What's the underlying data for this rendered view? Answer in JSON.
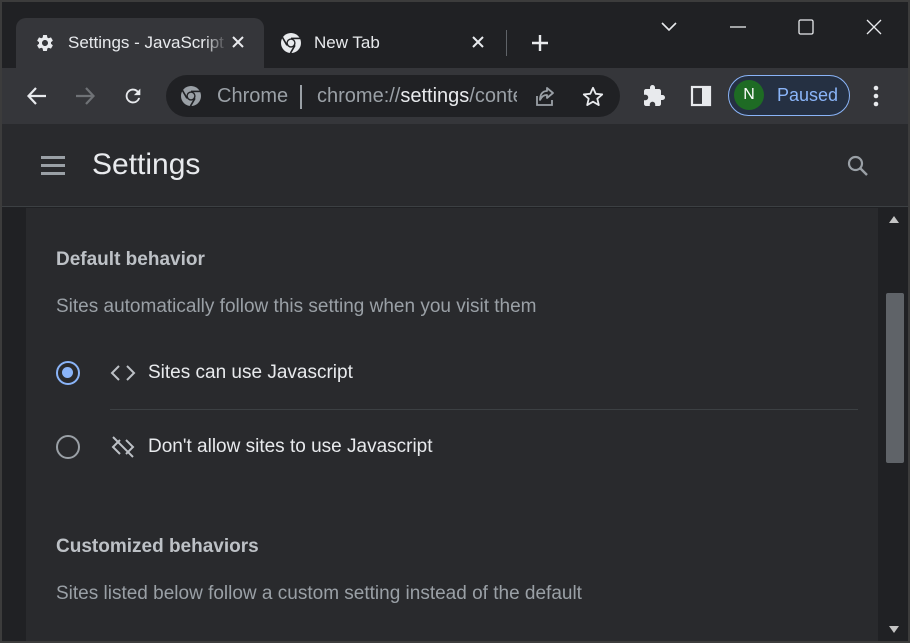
{
  "tabs": [
    {
      "title": "Settings - JavaScript",
      "icon": "gear-icon",
      "active": true
    },
    {
      "title": "New Tab",
      "icon": "chrome-icon",
      "active": false
    }
  ],
  "omnibox": {
    "chip": "Chrome",
    "url_scheme": "chrome://",
    "url_host": "settings",
    "url_rest": "/content/javascript"
  },
  "profile": {
    "initial": "N",
    "status": "Paused",
    "avatar_color": "#1e6b24"
  },
  "settings_header": {
    "title": "Settings"
  },
  "content": {
    "default_behavior": {
      "title": "Default behavior",
      "description": "Sites automatically follow this setting when you visit them",
      "options": [
        {
          "label": "Sites can use Javascript",
          "icon": "code-icon",
          "selected": true
        },
        {
          "label": "Don't allow sites to use Javascript",
          "icon": "code-off-icon",
          "selected": false
        }
      ]
    },
    "customized_behaviors": {
      "title": "Customized behaviors",
      "description": "Sites listed below follow a custom setting instead of the default"
    }
  },
  "colors": {
    "accent": "#8ab4f8",
    "background": "#202124",
    "card": "#292a2d",
    "toolbar": "#35363a"
  }
}
